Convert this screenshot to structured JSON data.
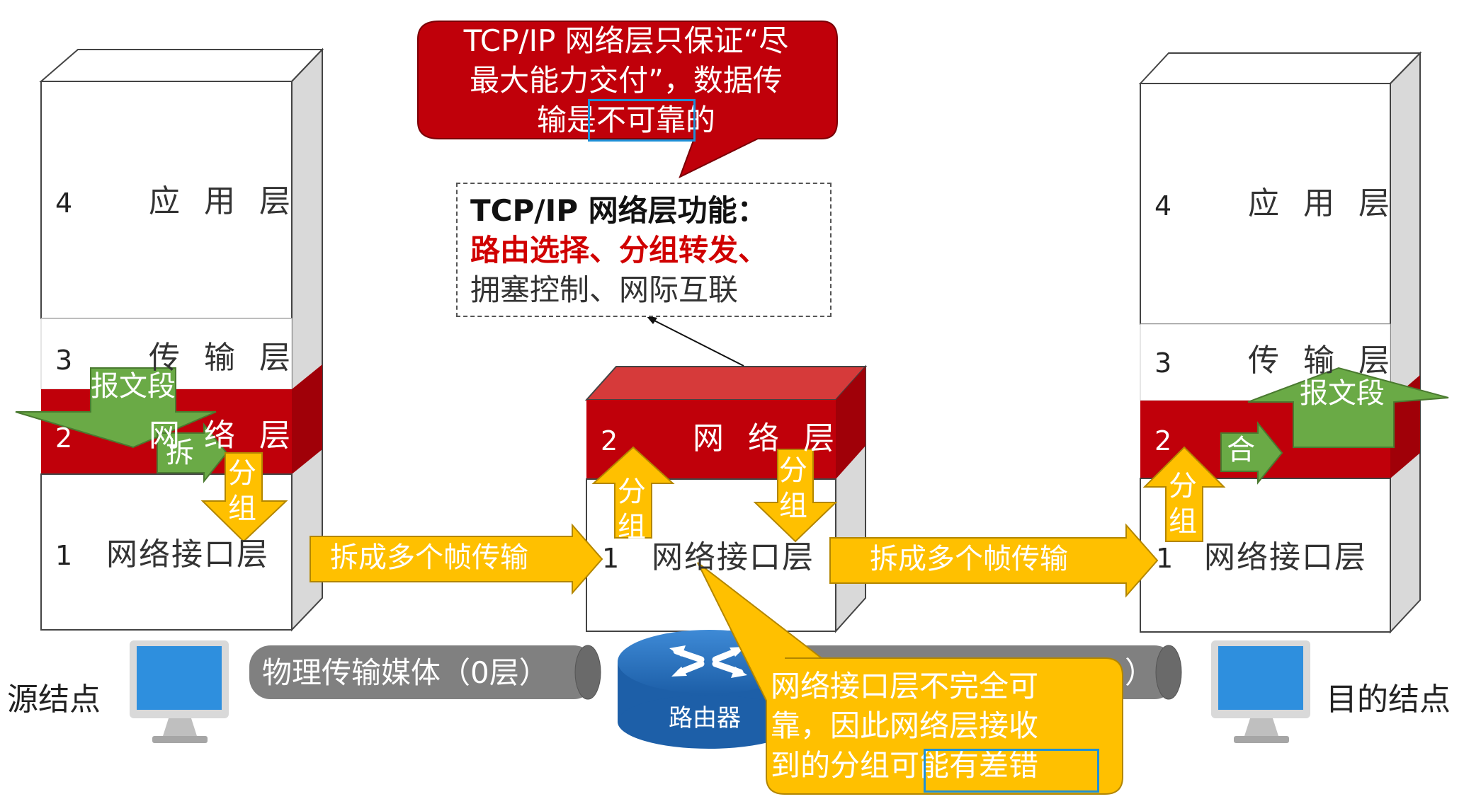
{
  "callouts": {
    "red_line1": "TCP/IP 网络层只保证“尽",
    "red_line2": "最大能力交付”，数据传",
    "red_line3_a": "输是",
    "red_line3_b": "不可靠",
    "red_line3_c": "的",
    "func_title": "TCP/IP 网络层功能：",
    "func_red": "路由选择、分组转发、",
    "func_rest": "拥塞控制、网际互联",
    "yellow_line1": "网络接口层不完全可",
    "yellow_line2": "靠，因此网络层接收",
    "yellow_line3_a": "到的分组",
    "yellow_line3_b": "可能有差错"
  },
  "source": {
    "label": "源结点",
    "layers": [
      {
        "num": "4",
        "name": "应 用 层"
      },
      {
        "num": "3",
        "name": "传 输 层"
      },
      {
        "num": "2",
        "name": "网 络 层"
      },
      {
        "num": "1",
        "name": "网络接口层"
      }
    ],
    "segment": "报文段",
    "split": "拆",
    "packet": "分组"
  },
  "router": {
    "label": "路由器",
    "layers": [
      {
        "num": "2",
        "name": "网 络 层"
      },
      {
        "num": "1",
        "name": "网络接口层"
      }
    ],
    "packet_up": "分组",
    "packet_down": "分组"
  },
  "dest": {
    "label": "目的结点",
    "layers": [
      {
        "num": "4",
        "name": "应 用 层"
      },
      {
        "num": "3",
        "name": "传 输 层"
      },
      {
        "num": "2",
        "name": "网 络 层"
      },
      {
        "num": "1",
        "name": "网络接口层"
      }
    ],
    "segment": "报文段",
    "merge": "合",
    "packet": "分组"
  },
  "links": {
    "frames1": "拆成多个帧传输",
    "frames2": "拆成多个帧传输",
    "media": "物理传输媒体（0层）",
    "media2_tail": "）"
  },
  "colors": {
    "red": "#c0000a",
    "green": "#6aaa46",
    "yellow": "#ffc000",
    "blue": "#1e90d8",
    "gray": "#7f7f7f"
  }
}
